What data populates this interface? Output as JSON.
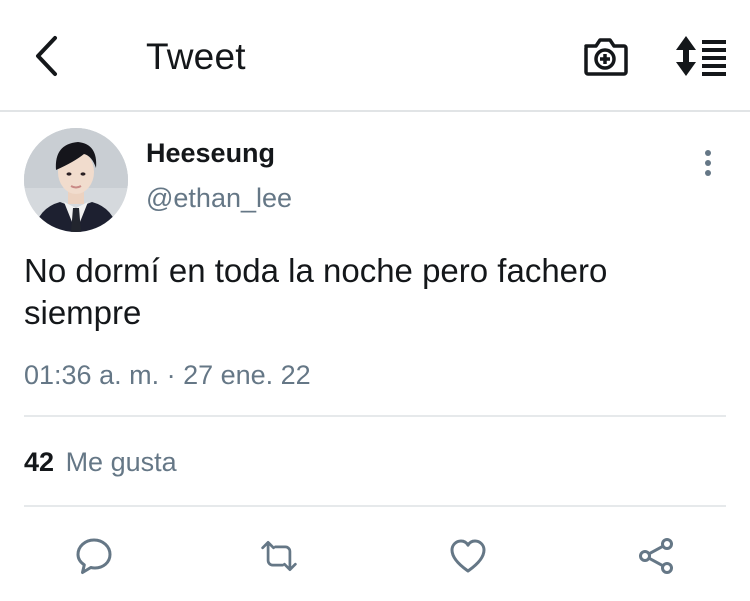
{
  "header": {
    "title": "Tweet",
    "icons": {
      "back": "chevron-left-icon",
      "camera": "camera-plus-icon",
      "sort": "sort-list-icon"
    }
  },
  "tweet": {
    "author_name": "Heeseung",
    "author_handle": "@ethan_lee",
    "text": "No dormí en toda la noche pero fachero siempre",
    "timestamp": "01:36 a. m. · 27 ene. 22",
    "likes_count": "42",
    "likes_label": "Me gusta"
  },
  "actions": {
    "icons": [
      "reply-icon",
      "retweet-icon",
      "heart-icon",
      "share-icon"
    ]
  },
  "colors": {
    "text_primary": "#14171a",
    "text_secondary": "#657786",
    "divider": "#e6e9eb"
  }
}
